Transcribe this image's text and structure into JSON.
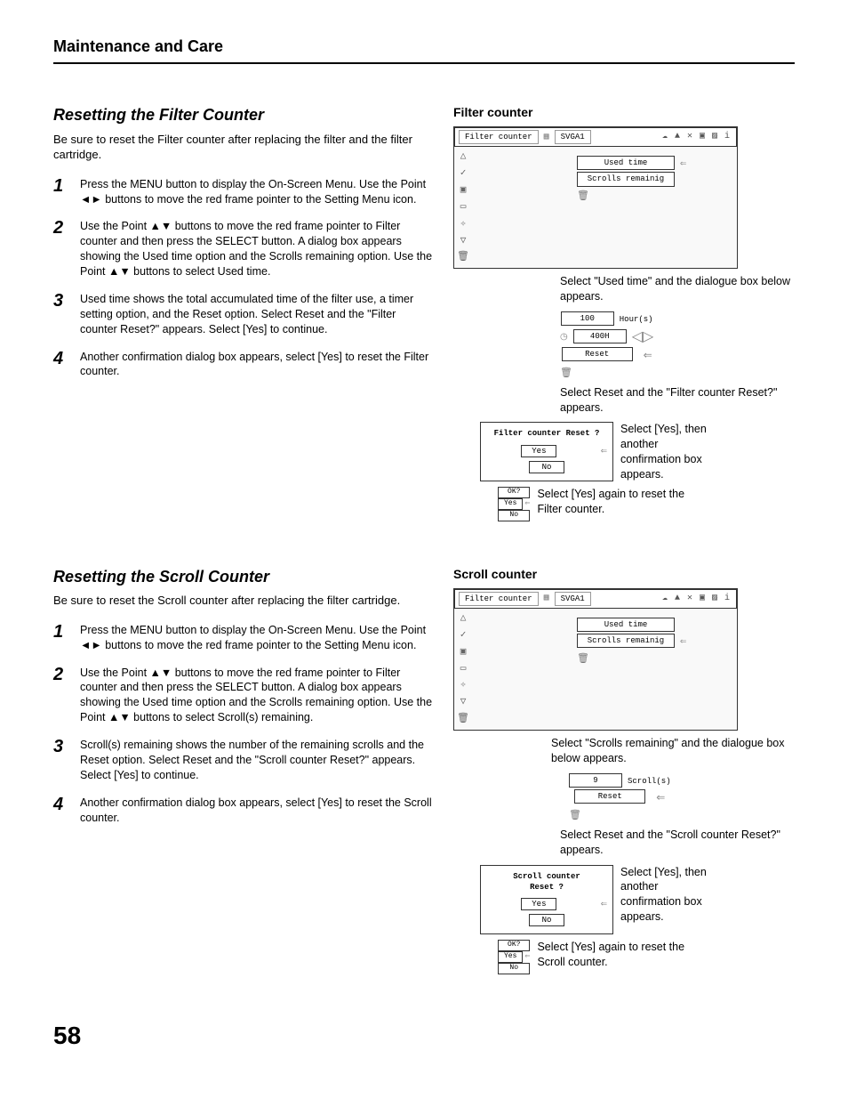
{
  "header": {
    "chapter": "Maintenance and Care"
  },
  "page_number": "58",
  "sectionA": {
    "title": "Resetting the Filter Counter",
    "intro": "Be sure to reset the Filter counter after replacing the filter and the filter cartridge.",
    "steps": {
      "s1": "Press the MENU button to display the On-Screen Menu. Use the Point ◄► buttons to move the red frame pointer to the Setting Menu icon.",
      "s2": "Use the Point ▲▼ buttons to move the red frame pointer to Filter counter and then press the SELECT button. A dialog box appears showing the Used time option and the Scrolls remaining option. Use the Point ▲▼ buttons to select  Used time.",
      "s3": "Used time shows the total accumulated time of the filter use, a timer setting option, and the Reset option. Select Reset and the \"Filter counter Reset?\" appears. Select [Yes] to continue.",
      "s4": "Another confirmation dialog box appears, select [Yes] to reset the Filter counter."
    },
    "right": {
      "title": "Filter counter",
      "menu_label": "Filter counter",
      "signal": "SVGA1",
      "opt1": "Used time",
      "opt2": "Scrolls remainig",
      "cap1": "Select \"Used time\" and the dialogue box below appears.",
      "val100": "100",
      "hours": "Hour(s)",
      "val400": "400H",
      "reset": "Reset",
      "cap2": "Select Reset and the \"Filter counter Reset?\" appears.",
      "confirm_q": "Filter counter Reset ?",
      "yes": "Yes",
      "no": "No",
      "cap3": "Select [Yes], then another confirmation box appears.",
      "ok": "OK?",
      "cap4": "Select [Yes] again to reset the Filter counter."
    }
  },
  "sectionB": {
    "title": "Resetting the Scroll Counter",
    "intro": "Be sure to reset the Scroll counter after replacing the filter cartridge.",
    "steps": {
      "s1": "Press the MENU button to display the On-Screen Menu. Use the Point ◄► buttons to move the red frame pointer to the Setting Menu icon.",
      "s2": "Use the Point ▲▼ buttons to move the red frame pointer to Filter counter and then press the SELECT button. A dialog box appears showing the Used time option and the Scrolls remaining option. Use the Point ▲▼ buttons to select Scroll(s) remaining.",
      "s3": "Scroll(s) remaining shows the number of the remaining scrolls and the Reset option. Select Reset and the \"Scroll counter Reset?\" appears. Select [Yes] to continue.",
      "s4": "Another confirmation dialog box appears, select [Yes] to reset the Scroll counter."
    },
    "right": {
      "title": "Scroll counter",
      "menu_label": "Filter counter",
      "signal": "SVGA1",
      "opt1": "Used time",
      "opt2": "Scrolls remainig",
      "cap1": "Select \"Scrolls remaining\" and the dialogue box below appears.",
      "val9": "9",
      "scrolls": "Scroll(s)",
      "reset": "Reset",
      "cap2": "Select Reset and the \"Scroll counter Reset?\" appears.",
      "confirm_q": "Scroll counter Reset ?",
      "yes": "Yes",
      "no": "No",
      "cap3": "Select [Yes], then another confirmation box appears.",
      "ok": "OK?",
      "cap4": "Select [Yes] again to reset the Scroll counter."
    }
  }
}
